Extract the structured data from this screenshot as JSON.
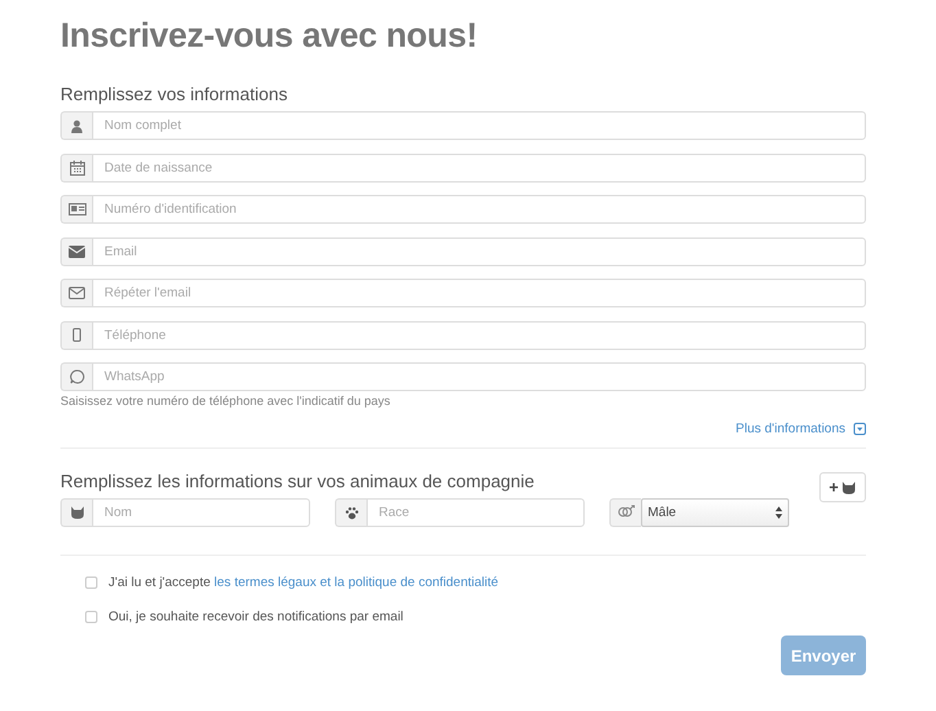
{
  "title": "Inscrivez-vous avec nous!",
  "personal": {
    "heading": "Remplissez vos informations",
    "fields": [
      {
        "kind": "user",
        "placeholder": "Nom complet"
      },
      {
        "kind": "calendar",
        "placeholder": "Date de naissance"
      },
      {
        "kind": "idcard",
        "placeholder": "Numéro d'identification"
      },
      {
        "kind": "envelope",
        "placeholder": "Email"
      },
      {
        "kind": "envelope-outline",
        "placeholder": "Répéter l'email"
      },
      {
        "kind": "phone",
        "placeholder": "Téléphone"
      },
      {
        "kind": "whatsapp",
        "placeholder": "WhatsApp"
      }
    ],
    "help": "Saisissez votre numéro de téléphone avec l'indicatif du pays",
    "more_link": "Plus d'informations"
  },
  "pets": {
    "heading": "Remplissez les informations sur vos animaux de compagnie",
    "name": {
      "kind": "cat",
      "placeholder": "Nom"
    },
    "breed": {
      "kind": "paw",
      "placeholder": "Race"
    },
    "sex": {
      "kind": "gender",
      "value": "Mâle"
    },
    "add_button": "+"
  },
  "consents": [
    {
      "text": "J'ai lu et j'accepte ",
      "link": "les termes légaux et la politique de confidentialité",
      "checked": false
    },
    {
      "text": "Oui, je souhaite recevoir des notifications par email",
      "checked": false
    }
  ],
  "submit": "Envoyer"
}
